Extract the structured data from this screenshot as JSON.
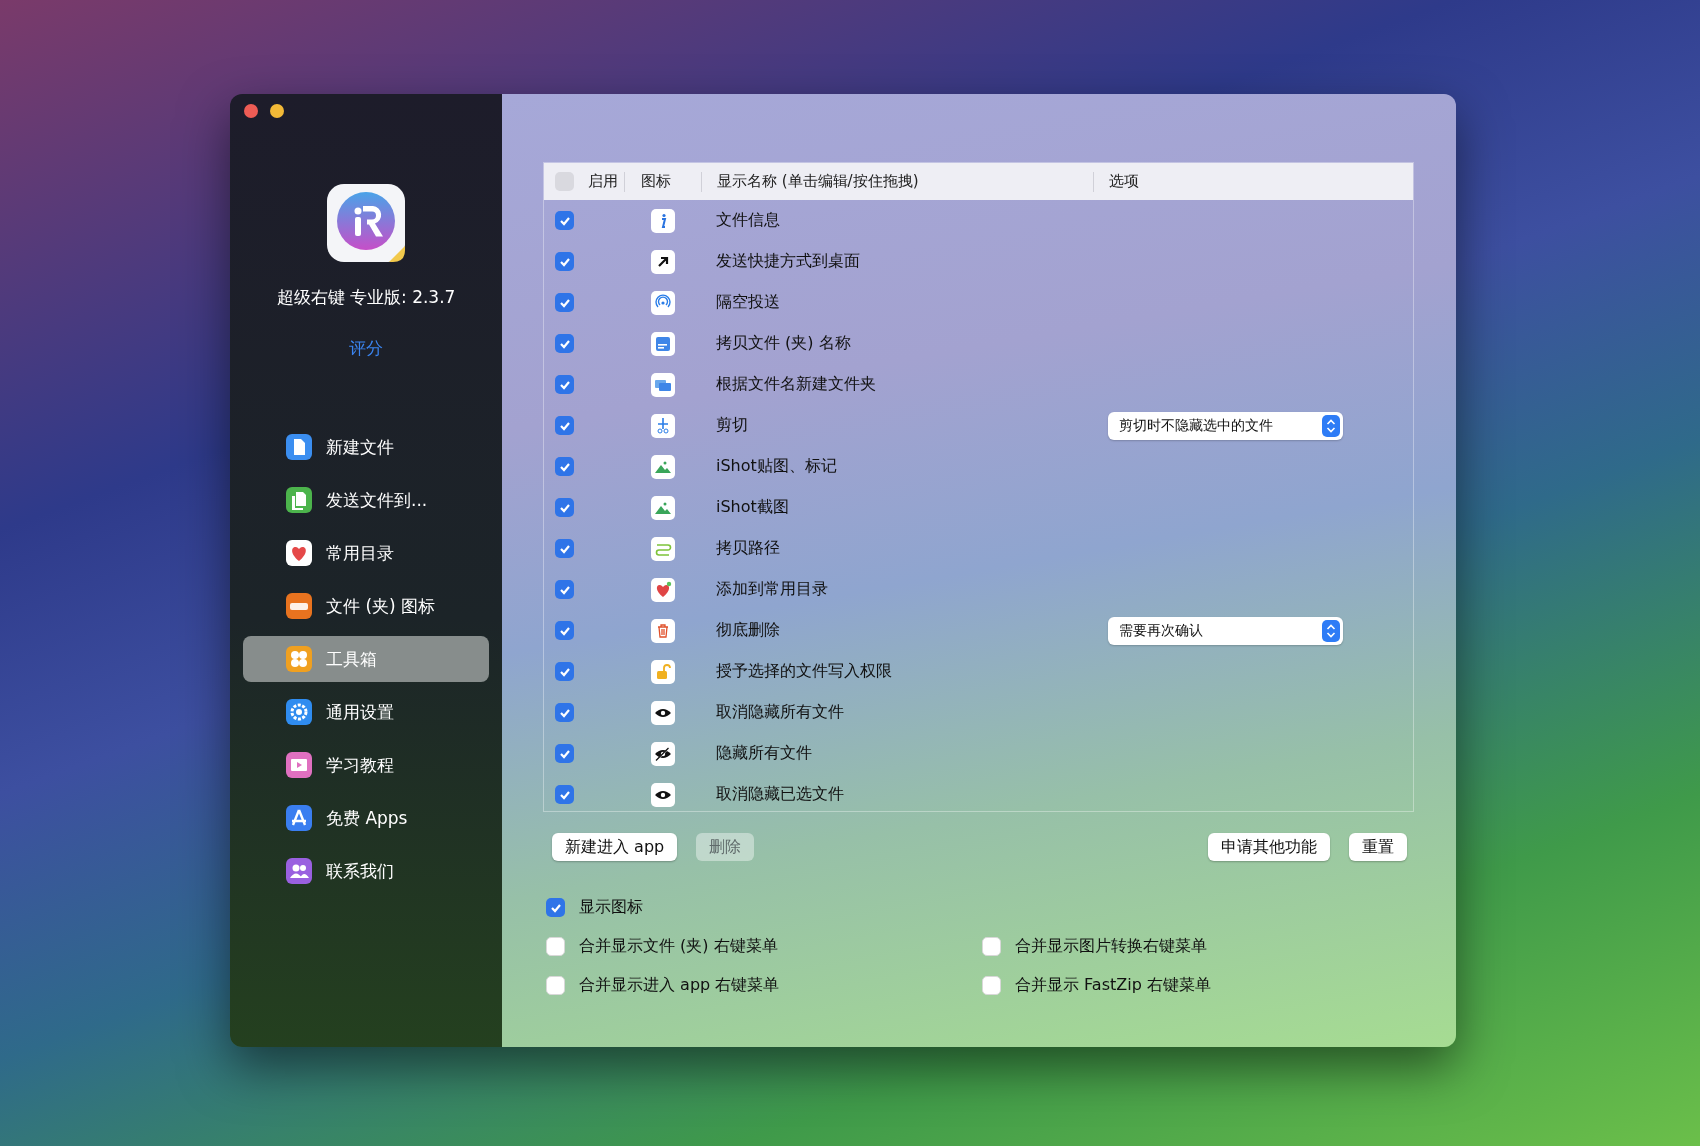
{
  "app": {
    "title": "超级右键 专业版: 2.3.7",
    "rate_link": "评分"
  },
  "sidebar": {
    "items": [
      {
        "label": "新建文件",
        "selected": false
      },
      {
        "label": "发送文件到...",
        "selected": false
      },
      {
        "label": "常用目录",
        "selected": false
      },
      {
        "label": "文件 (夹) 图标",
        "selected": false
      },
      {
        "label": "工具箱",
        "selected": true
      },
      {
        "label": "通用设置",
        "selected": false
      },
      {
        "label": "学习教程",
        "selected": false
      },
      {
        "label": "免费 Apps",
        "selected": false
      },
      {
        "label": "联系我们",
        "selected": false
      }
    ]
  },
  "table": {
    "select_all": {
      "checked": false
    },
    "columns": [
      "启用",
      "图标",
      "显示名称 (单击编辑/按住拖拽)",
      "选项"
    ],
    "rows": [
      {
        "enabled": true,
        "name": "文件信息"
      },
      {
        "enabled": true,
        "name": "发送快捷方式到桌面"
      },
      {
        "enabled": true,
        "name": "隔空投送"
      },
      {
        "enabled": true,
        "name": "拷贝文件 (夹) 名称"
      },
      {
        "enabled": true,
        "name": "根据文件名新建文件夹"
      },
      {
        "enabled": true,
        "name": "剪切",
        "option": "剪切时不隐藏选中的文件"
      },
      {
        "enabled": true,
        "name": "iShot贴图、标记"
      },
      {
        "enabled": true,
        "name": "iShot截图"
      },
      {
        "enabled": true,
        "name": "拷贝路径"
      },
      {
        "enabled": true,
        "name": "添加到常用目录"
      },
      {
        "enabled": true,
        "name": "彻底删除",
        "option": "需要再次确认"
      },
      {
        "enabled": true,
        "name": "授予选择的文件写入权限"
      },
      {
        "enabled": true,
        "name": "取消隐藏所有文件"
      },
      {
        "enabled": true,
        "name": "隐藏所有文件"
      },
      {
        "enabled": true,
        "name": "取消隐藏已选文件"
      }
    ]
  },
  "buttons_left": [
    {
      "label": "新建进入 app",
      "disabled": false
    },
    {
      "label": "删除",
      "disabled": true
    }
  ],
  "buttons_right": [
    {
      "label": "申请其他功能",
      "disabled": false
    },
    {
      "label": "重置",
      "disabled": false
    }
  ],
  "options": [
    {
      "label": "显示图标",
      "checked": true
    },
    {
      "label": "合并显示文件 (夹) 右键菜单",
      "checked": false
    },
    {
      "label": "合并显示图片转换右键菜单",
      "checked": false
    },
    {
      "label": "合并显示进入 app 右键菜单",
      "checked": false
    },
    {
      "label": "合并显示 FastZip 右键菜单",
      "checked": false
    }
  ]
}
